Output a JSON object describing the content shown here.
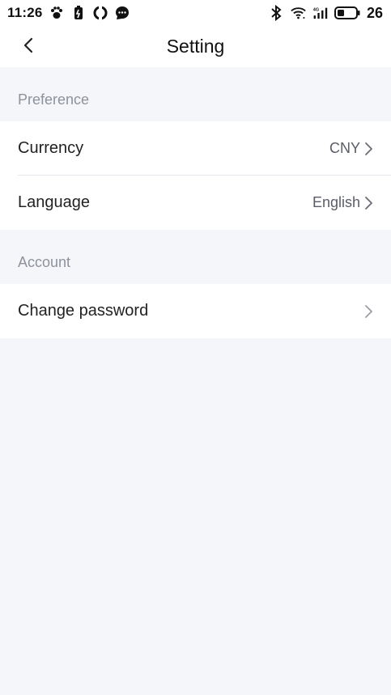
{
  "status_bar": {
    "time": "11:26",
    "left_icons": [
      "paw-icon",
      "battery-saver-icon",
      "sync-icon",
      "message-icon"
    ],
    "right_icons": [
      "bluetooth-icon",
      "wifi-icon",
      "signal-4g-icon",
      "battery-icon"
    ],
    "battery_level": "26"
  },
  "header": {
    "title": "Setting",
    "back_icon": "chevron-left-icon"
  },
  "sections": [
    {
      "label": "Preference",
      "rows": [
        {
          "label": "Currency",
          "value": "CNY"
        },
        {
          "label": "Language",
          "value": "English"
        }
      ]
    },
    {
      "label": "Account",
      "rows": [
        {
          "label": "Change password",
          "value": ""
        }
      ]
    }
  ],
  "colors": {
    "background": "#f5f6fa",
    "surface": "#ffffff",
    "section_label": "#8f929b",
    "value_text": "#5a5d66"
  }
}
